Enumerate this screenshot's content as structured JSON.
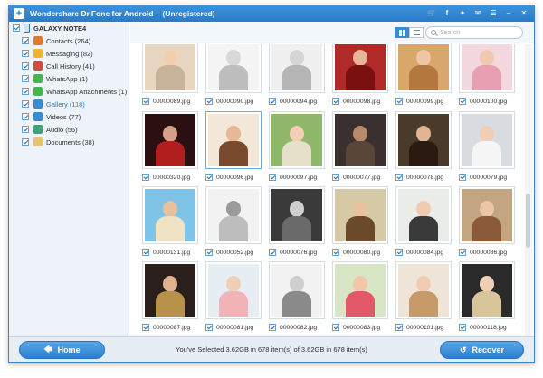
{
  "window": {
    "title": "Wondershare Dr.Fone for Android",
    "status": "(Unregistered)",
    "title_icons": [
      "cart-icon",
      "facebook-icon",
      "twitter-icon",
      "feedback-icon",
      "menu-icon",
      "minimize-icon",
      "close-icon"
    ]
  },
  "sidebar": {
    "device": "GALAXY NOTE4",
    "items": [
      {
        "label": "Contacts (264)",
        "icon": "contacts-icon",
        "color": "#e0792a"
      },
      {
        "label": "Messaging (82)",
        "icon": "messaging-icon",
        "color": "#f0b429"
      },
      {
        "label": "Call History (41)",
        "icon": "call-history-icon",
        "color": "#d24b3f"
      },
      {
        "label": "WhatsApp (1)",
        "icon": "whatsapp-icon",
        "color": "#3fb94a"
      },
      {
        "label": "WhatsApp Attachments (1)",
        "icon": "whatsapp-attachments-icon",
        "color": "#3fb94a"
      },
      {
        "label": "Gallery (118)",
        "icon": "gallery-icon",
        "color": "#3a8ad3",
        "active": true
      },
      {
        "label": "Videos (77)",
        "icon": "videos-icon",
        "color": "#3a8ad3"
      },
      {
        "label": "Audio (56)",
        "icon": "audio-icon",
        "color": "#3aa37a"
      },
      {
        "label": "Documents (38)",
        "icon": "documents-icon",
        "color": "#e8c46a"
      }
    ]
  },
  "toolbar": {
    "search_placeholder": "Search"
  },
  "gallery": {
    "photos": [
      {
        "name": "00000089.jpg",
        "bg": "#e8d6c0",
        "face": "#f2cfb0",
        "body": "#c7b49a"
      },
      {
        "name": "00000090.jpg",
        "bg": "#f4f4f4",
        "face": "#d9d9d9",
        "body": "#bdbdbd"
      },
      {
        "name": "00000094.jpg",
        "bg": "#f0f0f0",
        "face": "#d6d6d6",
        "body": "#b5b5b5"
      },
      {
        "name": "00000098.jpg",
        "bg": "#b02a2a",
        "face": "#e8b49a",
        "body": "#7a1010"
      },
      {
        "name": "00000099.jpg",
        "bg": "#d9a66b",
        "face": "#f0c7a5",
        "body": "#b4783e"
      },
      {
        "name": "00000100.jpg",
        "bg": "#f3d9df",
        "face": "#f1c9b1",
        "body": "#e79fb2"
      },
      {
        "name": "00000320.jpg",
        "bg": "#2a1010",
        "face": "#d6a088",
        "body": "#b01e1e"
      },
      {
        "name": "00000096.jpg",
        "bg": "#f3e7da",
        "face": "#e7b896",
        "body": "#7a4a2c",
        "selected": true
      },
      {
        "name": "00000097.jpg",
        "bg": "#8fb86a",
        "face": "#f3d0b5",
        "body": "#e6e0c8"
      },
      {
        "name": "00000077.jpg",
        "bg": "#3a3030",
        "face": "#b78a6a",
        "body": "#5a4638"
      },
      {
        "name": "00000078.jpg",
        "bg": "#4a3a2a",
        "face": "#e2b592",
        "body": "#2a1a12"
      },
      {
        "name": "00000079.jpg",
        "bg": "#d8dbe0",
        "face": "#f1cdb3",
        "body": "#f5f5f5"
      },
      {
        "name": "00000131.jpg",
        "bg": "#7fc3e6",
        "face": "#e8c09e",
        "body": "#f0e2c4"
      },
      {
        "name": "00000052.jpg",
        "bg": "#f2f2f2",
        "face": "#9a9a9a",
        "body": "#bdbdbd"
      },
      {
        "name": "00000076.jpg",
        "bg": "#3a3a3a",
        "face": "#cfcfcf",
        "body": "#6a6a6a"
      },
      {
        "name": "00000080.jpg",
        "bg": "#d6c9a6",
        "face": "#e8c29e",
        "body": "#6a4a2a"
      },
      {
        "name": "00000084.jpg",
        "bg": "#e9ece9",
        "face": "#f0cbb0",
        "body": "#3a3a3a"
      },
      {
        "name": "00000086.jpg",
        "bg": "#c4a582",
        "face": "#eac6a6",
        "body": "#8a5a3a"
      },
      {
        "name": "00000087.jpg",
        "bg": "#2a1f1a",
        "face": "#e0b290",
        "body": "#b8924a"
      },
      {
        "name": "00000081.jpg",
        "bg": "#e6eef4",
        "face": "#f1cfb6",
        "body": "#f2b3b8"
      },
      {
        "name": "00000082.jpg",
        "bg": "#f2f2f2",
        "face": "#cfcfcf",
        "body": "#8a8a8a"
      },
      {
        "name": "00000083.jpg",
        "bg": "#d9e6c6",
        "face": "#f0c8a8",
        "body": "#e2596a"
      },
      {
        "name": "00000101.jpg",
        "bg": "#efe4d8",
        "face": "#f0cdb2",
        "body": "#c79a6a"
      },
      {
        "name": "00000118.jpg",
        "bg": "#2a2a2a",
        "face": "#f0d0b4",
        "body": "#d8c59a"
      }
    ]
  },
  "footer": {
    "home_label": "Home",
    "recover_label": "Recover",
    "status": "You've Selected 3.62GB in 678 item(s) of 3.62GB in 678 item(s)"
  }
}
